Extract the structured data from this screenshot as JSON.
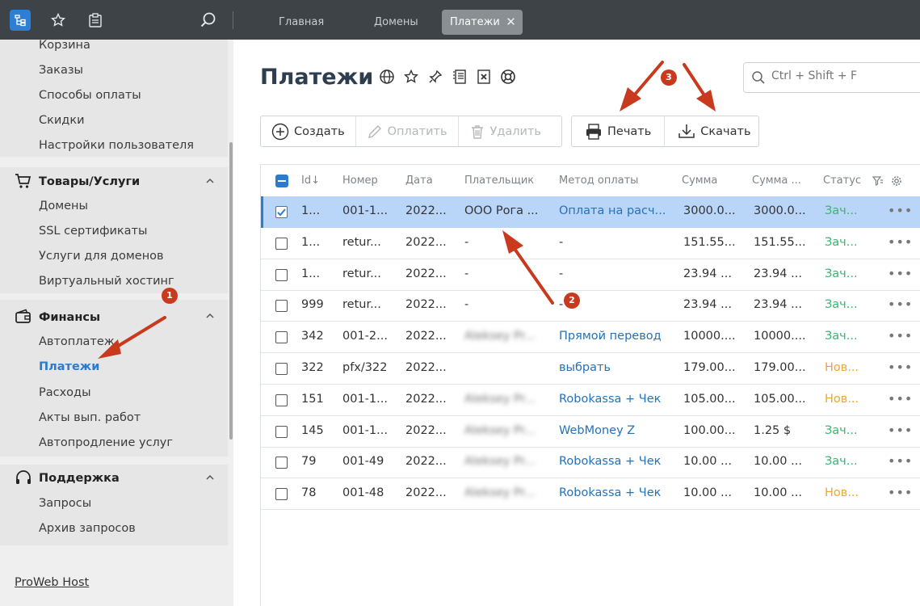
{
  "topbar": {
    "tabs": [
      "Главная",
      "Домены",
      "Платежи"
    ],
    "close_glyph": "✕",
    "icons": [
      "app-logo-icon",
      "star-icon",
      "clipboard-icon",
      "search-icon"
    ]
  },
  "sidebar": {
    "top_items": [
      "Корзина",
      "Заказы",
      "Способы оплаты",
      "Скидки",
      "Настройки пользователя"
    ],
    "groups": [
      {
        "title": "Товары/Услуги",
        "icon": "cart-icon",
        "items": [
          "Домены",
          "SSL сертификаты",
          "Услуги для доменов",
          "Виртуальный хостинг"
        ]
      },
      {
        "title": "Финансы",
        "icon": "wallet-icon",
        "items": [
          "Автоплатеж",
          "Платежи",
          "Расходы",
          "Акты вып. работ",
          "Автопродление услуг"
        ]
      },
      {
        "title": "Поддержка",
        "icon": "headset-icon",
        "items": [
          "Запросы",
          "Архив запросов"
        ]
      }
    ],
    "footer": "ProWeb Host"
  },
  "main": {
    "title": "Платежи",
    "search_placeholder": "Ctrl + Shift + F",
    "toolbar": {
      "create": "Создать",
      "pay": "Оплатить",
      "delete": "Удалить",
      "print": "Печать",
      "download": "Скачать"
    },
    "columns": [
      "Id",
      "Номер",
      "Дата",
      "Плательщик",
      "Метод оплаты",
      "Сумма",
      "Сумма ...",
      "Статус"
    ],
    "sort_arrow": "↓",
    "rows": [
      {
        "id": "1...",
        "number": "001-1...",
        "date": "2022...",
        "payer": "ООО Рога ...",
        "method": "Оплата на расч...",
        "sum": "3000.0...",
        "sum2": "3000.0...",
        "status": "Зач...",
        "status_color": "green",
        "payer_blur": false,
        "selected": true
      },
      {
        "id": "1...",
        "number": "retur...",
        "date": "2022...",
        "payer": "-",
        "method": "-",
        "sum": "151.55...",
        "sum2": "151.55...",
        "status": "Зач...",
        "status_color": "green",
        "payer_blur": false,
        "selected": false
      },
      {
        "id": "1...",
        "number": "retur...",
        "date": "2022...",
        "payer": "-",
        "method": "-",
        "sum": "23.94 ...",
        "sum2": "23.94 ...",
        "status": "Зач...",
        "status_color": "green",
        "payer_blur": false,
        "selected": false
      },
      {
        "id": "999",
        "number": "retur...",
        "date": "2022...",
        "payer": "-",
        "method": "-",
        "sum": "23.94 ...",
        "sum2": "23.94 ...",
        "status": "Зач...",
        "status_color": "green",
        "payer_blur": false,
        "selected": false
      },
      {
        "id": "342",
        "number": "001-2...",
        "date": "2022...",
        "payer": "Aleksey Pr...",
        "method": "Прямой перевод",
        "sum": "10000....",
        "sum2": "10000....",
        "status": "Зач...",
        "status_color": "green",
        "payer_blur": true,
        "selected": false
      },
      {
        "id": "322",
        "number": "pfx/322",
        "date": "2022...",
        "payer": "",
        "method": "выбрать",
        "sum": "179.00...",
        "sum2": "179.00...",
        "status": "Нов...",
        "status_color": "orange",
        "payer_blur": true,
        "selected": false
      },
      {
        "id": "151",
        "number": "001-1...",
        "date": "2022...",
        "payer": "Aleksey Pr...",
        "method": "Robokassa + Чек",
        "sum": "105.00...",
        "sum2": "105.00...",
        "status": "Нов...",
        "status_color": "orange",
        "payer_blur": true,
        "selected": false
      },
      {
        "id": "145",
        "number": "001-1...",
        "date": "2022...",
        "payer": "Aleksey Pr...",
        "method": "WebMoney Z",
        "sum": "100.00...",
        "sum2": "1.25 $",
        "status": "Зач...",
        "status_color": "green",
        "payer_blur": true,
        "selected": false
      },
      {
        "id": "79",
        "number": "001-49",
        "date": "2022...",
        "payer": "Aleksey Pr...",
        "method": "Robokassa + Чек",
        "sum": "10.00 ...",
        "sum2": "10.00 ...",
        "status": "Зач...",
        "status_color": "green",
        "payer_blur": true,
        "selected": false
      },
      {
        "id": "78",
        "number": "001-48",
        "date": "2022...",
        "payer": "Aleksey Pr...",
        "method": "Robokassa + Чек",
        "sum": "10.00 ...",
        "sum2": "10.00 ...",
        "status": "Нов...",
        "status_color": "orange",
        "payer_blur": true,
        "selected": false
      }
    ],
    "row_menu_glyph": "•••"
  },
  "annotations": {
    "badges": [
      "1",
      "2",
      "3"
    ]
  },
  "colors": {
    "accent": "#2b7bd0",
    "annotation": "#c8391e",
    "status_green": "#3cb371",
    "status_orange": "#f0a531"
  }
}
